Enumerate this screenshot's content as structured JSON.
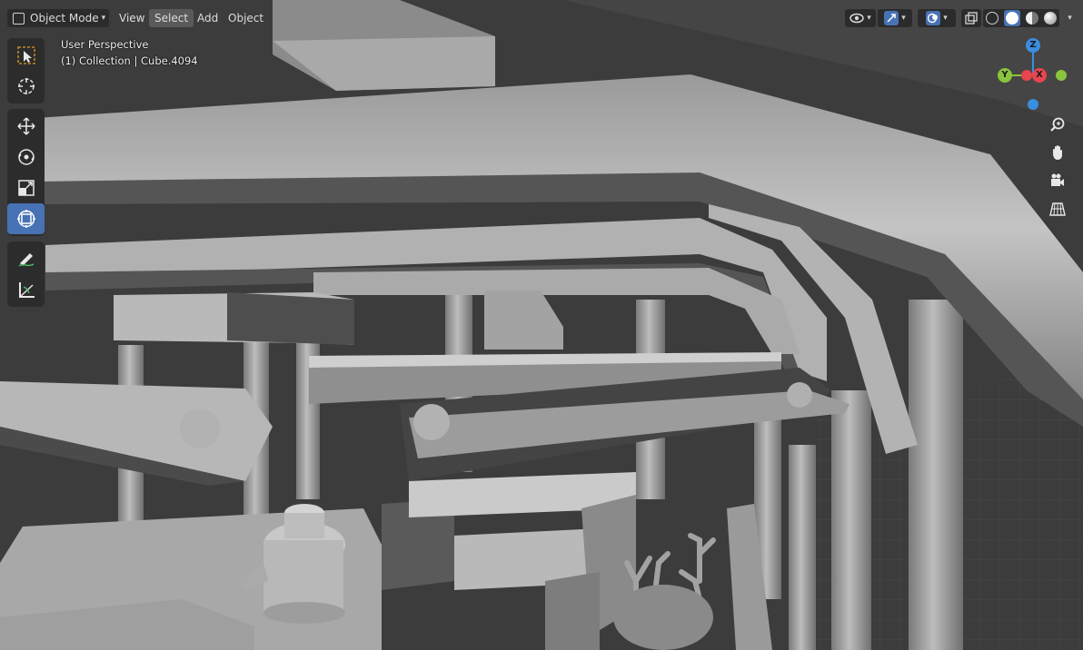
{
  "header": {
    "mode_label": "Object Mode",
    "menu": [
      "View",
      "Select",
      "Add",
      "Object"
    ],
    "active_menu": "Select"
  },
  "overlay": {
    "perspective": "User Perspective",
    "collection": "(1) Collection | Cube.4094"
  },
  "toolbar": {
    "tools": [
      "select-box-icon",
      "cursor-icon",
      "move-icon",
      "rotate-icon",
      "scale-icon",
      "transform-icon",
      "annotate-icon",
      "measure-icon"
    ],
    "active_tool": "transform-icon"
  },
  "gizmo": {
    "axes": [
      "X",
      "Y",
      "Z"
    ],
    "colors": {
      "x": "#e8454f",
      "y": "#8ac43c",
      "z": "#3a8ee0"
    }
  },
  "nav_buttons": [
    "zoom-icon",
    "hand-icon",
    "camera-icon",
    "grid-icon"
  ],
  "shading_modes": [
    "wireframe",
    "solid",
    "material",
    "rendered"
  ],
  "active_shading": "solid",
  "colors": {
    "accent": "#4772b3",
    "header_bg": "#303030",
    "toolbar_bg": "#2c2c2c"
  }
}
